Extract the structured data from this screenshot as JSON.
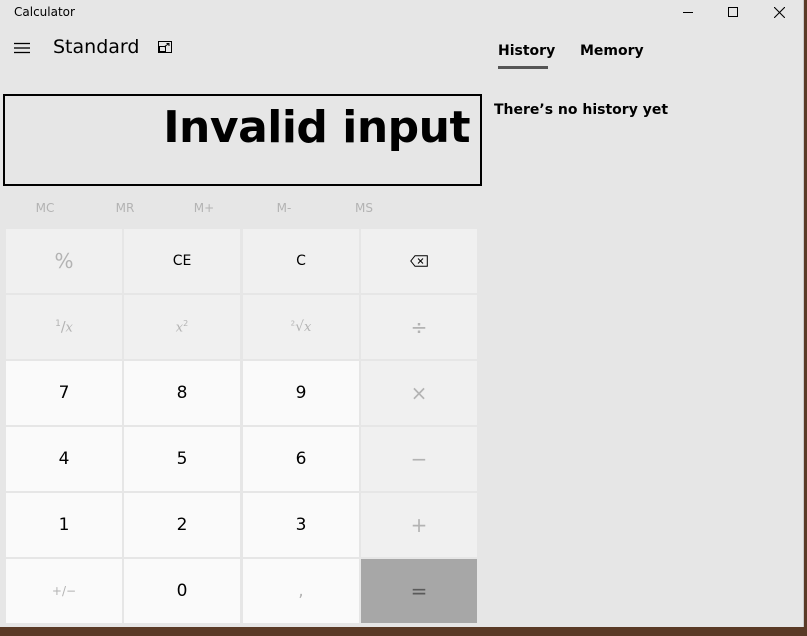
{
  "window": {
    "title": "Calculator"
  },
  "header": {
    "mode": "Standard"
  },
  "display": {
    "text": "Invalid input"
  },
  "memory": {
    "buttons": [
      "MC",
      "MR",
      "M+",
      "M-",
      "MS"
    ]
  },
  "keypad": {
    "percent": "%",
    "ce": "CE",
    "c": "C",
    "reciprocal_x": "x",
    "square_x": "x",
    "square_exp": "2",
    "cube_root_x": "x",
    "divide": "÷",
    "multiply": "×",
    "minus": "−",
    "plus": "+",
    "equals": "=",
    "negate": "+/−",
    "decimal": ",",
    "n0": "0",
    "n1": "1",
    "n2": "2",
    "n3": "3",
    "n4": "4",
    "n5": "5",
    "n6": "6",
    "n7": "7",
    "n8": "8",
    "n9": "9"
  },
  "panel": {
    "tabs": [
      "History",
      "Memory"
    ],
    "active_tab": "History",
    "empty_message": "There’s no history yet"
  },
  "colors": {
    "background": "#e6e6e6",
    "operator_key": "#f0f0f0",
    "number_key": "#fafafa",
    "equals_key": "#a7a7a7",
    "disabled_text": "#b3b3b3"
  }
}
